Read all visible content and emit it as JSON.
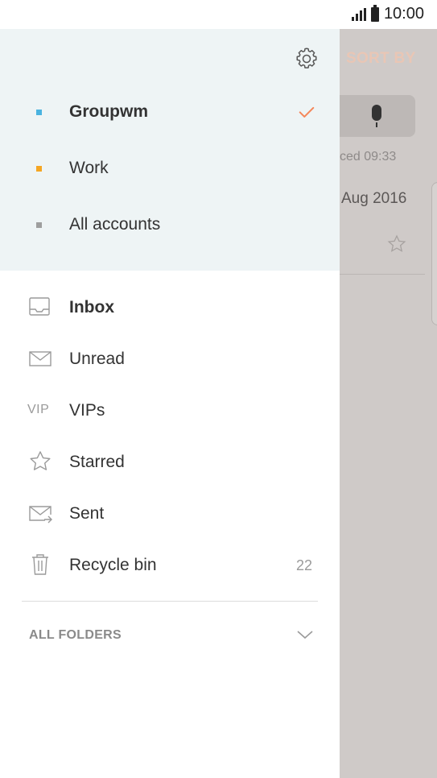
{
  "status_bar": {
    "time": "10:00"
  },
  "background": {
    "sort_label": "SORT BY",
    "synced_text": "ced  09:33",
    "date_text": "Aug 2016"
  },
  "accounts": [
    {
      "label": "Groupwm",
      "color": "#4ab3e0",
      "selected": true
    },
    {
      "label": "Work",
      "color": "#f5a623",
      "selected": false
    },
    {
      "label": "All accounts",
      "color": "#9e9e9e",
      "selected": false
    }
  ],
  "folders": [
    {
      "label": "Inbox",
      "icon": "inbox-icon",
      "bold": true
    },
    {
      "label": "Unread",
      "icon": "envelope-icon",
      "bold": false
    },
    {
      "label": "VIPs",
      "icon": "vip-icon",
      "icon_text": "VIP",
      "bold": false
    },
    {
      "label": "Starred",
      "icon": "star-icon",
      "bold": false
    },
    {
      "label": "Sent",
      "icon": "sent-icon",
      "bold": false
    },
    {
      "label": "Recycle bin",
      "icon": "trash-icon",
      "count": "22",
      "bold": false
    }
  ],
  "all_folders_label": "ALL FOLDERS",
  "colors": {
    "accent": "#f4875a",
    "drawer_header_bg": "#eef4f5",
    "scrim_bg": "#cfcac8"
  }
}
